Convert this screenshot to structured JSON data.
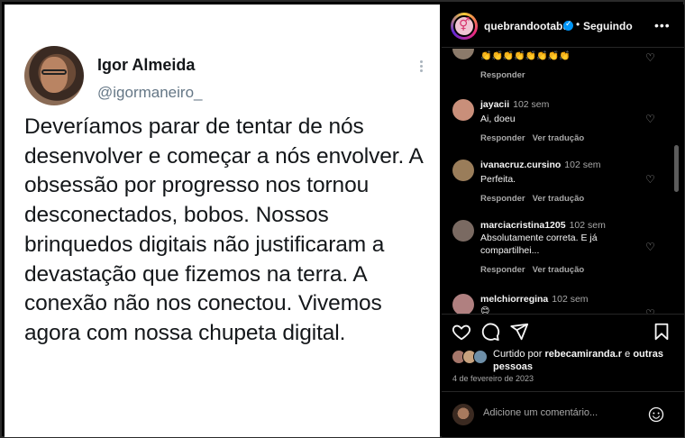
{
  "tweet": {
    "name": "Igor Almeida",
    "handle": "@igormaneiro_",
    "text": "Deveríamos parar de tentar de nós desenvolver e começar a nós envolver. A obsessão por progresso nos tornou desconectados, bobos. Nossos brinquedos digitais não justificaram a devastação que fizemos na terra. A conexão não nos conectou. Vivemos agora com nossa chupeta digital."
  },
  "header": {
    "username": "quebrandootabu",
    "separator": "•",
    "follow_label": "Seguindo",
    "more_label": "•••"
  },
  "comments": [
    {
      "user": "",
      "time": "",
      "text": "👏👏👏👏👏👏👏👏",
      "reply": "Responder",
      "translate": "",
      "avatar_color": "#8b7a6a"
    },
    {
      "user": "jayacii",
      "time": "102 sem",
      "text": "Ai, doeu",
      "reply": "Responder",
      "translate": "Ver tradução",
      "avatar_color": "#c98f7a"
    },
    {
      "user": "ivanacruz.cursino",
      "time": "102 sem",
      "text": "Perfeita.",
      "reply": "Responder",
      "translate": "Ver tradução",
      "avatar_color": "#9a7d5a"
    },
    {
      "user": "marciacristina1205",
      "time": "102 sem",
      "text": "Absolutamente correta. E já compartilhei...",
      "reply": "Responder",
      "translate": "Ver tradução",
      "avatar_color": "#7a6a62"
    },
    {
      "user": "melchiorregina",
      "time": "102 sem",
      "text": "😊",
      "reply": "",
      "translate": "",
      "avatar_color": "#b08080"
    }
  ],
  "post": {
    "liked_prefix": "Curtido por ",
    "liked_user": "rebecamiranda.r",
    "liked_mid": " e ",
    "liked_others": "outras pessoas",
    "date": "4 de fevereiro de 2023"
  },
  "comment_box": {
    "placeholder": "Adicione um comentário..."
  },
  "colors": {
    "accent": "#0095f6",
    "panel_bg": "#000000",
    "muted": "#a8a8a8"
  }
}
